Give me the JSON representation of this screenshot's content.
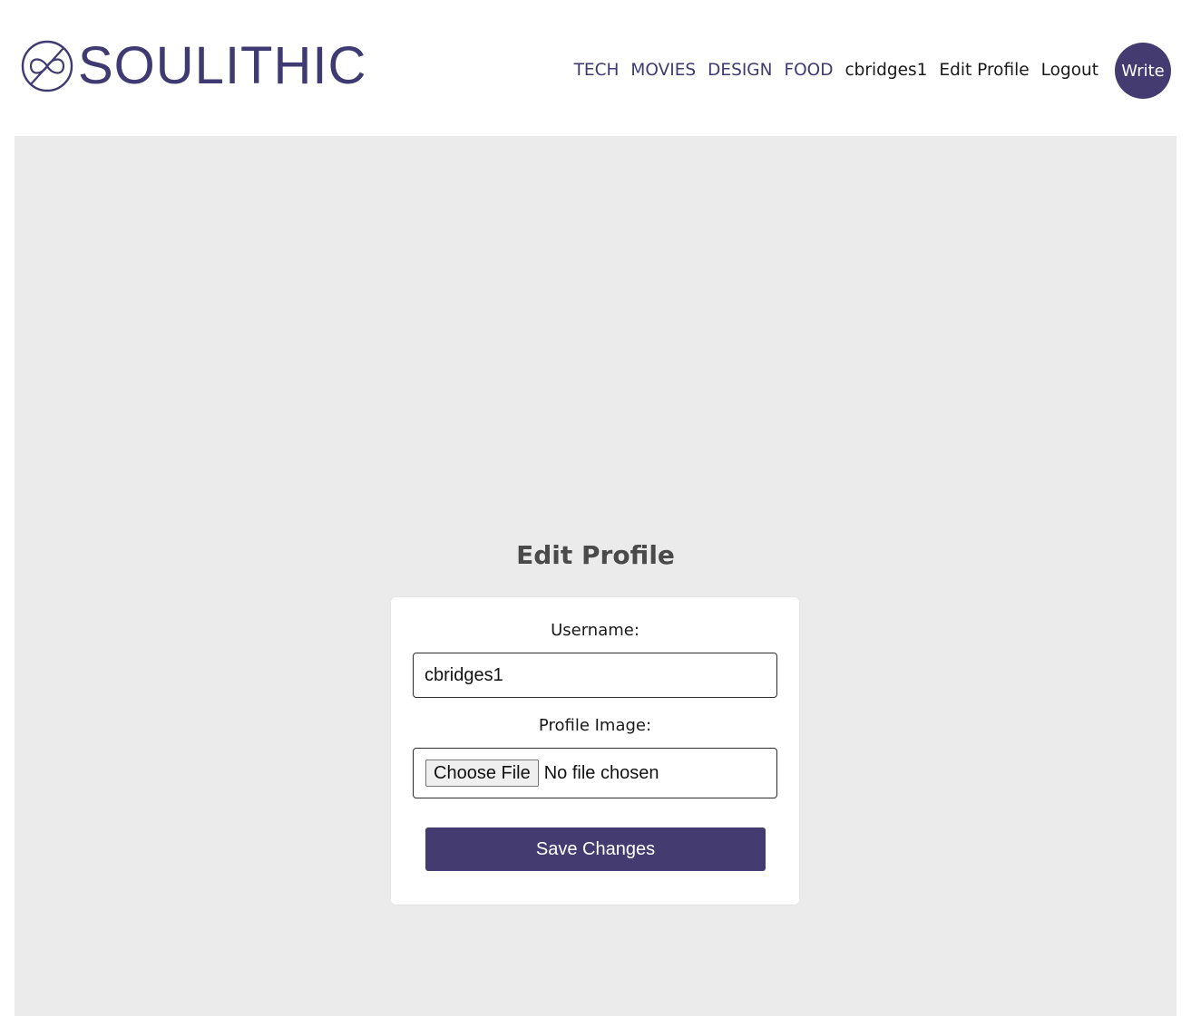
{
  "brand": {
    "name": "SOULITHIC",
    "logo_icon": "infinity-circle-icon",
    "color": "#3f3a71"
  },
  "nav": {
    "categories": [
      "TECH",
      "MOVIES",
      "DESIGN",
      "FOOD"
    ],
    "username": "cbridges1",
    "edit_profile": "Edit Profile",
    "logout": "Logout",
    "write": "Write"
  },
  "page": {
    "title": "Edit Profile"
  },
  "form": {
    "username_label": "Username:",
    "username_value": "cbridges1",
    "image_label": "Profile Image:",
    "file_button": "Choose File",
    "file_status": "No file chosen",
    "submit": "Save Changes"
  },
  "colors": {
    "accent": "#443b70",
    "background": "#ebebeb",
    "card": "#ffffff"
  }
}
